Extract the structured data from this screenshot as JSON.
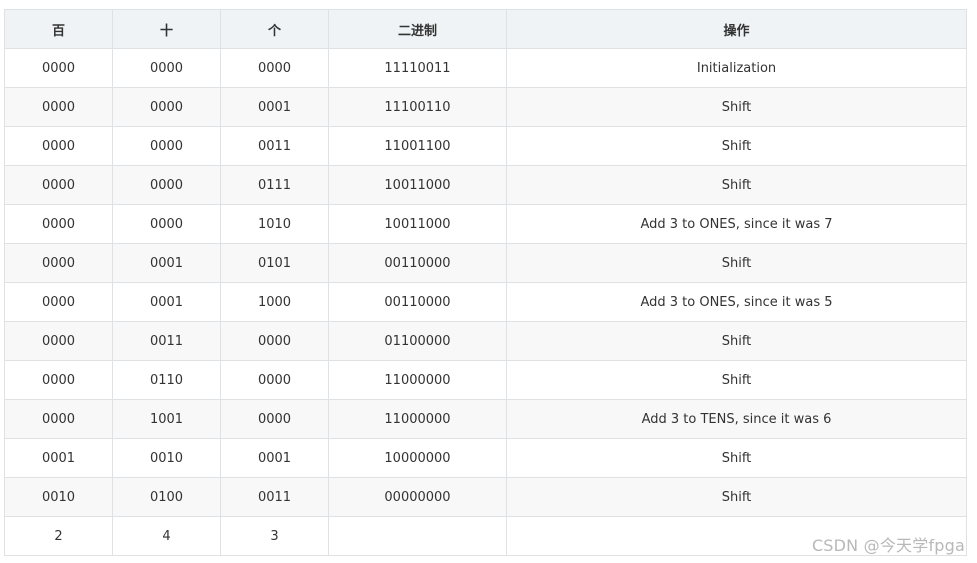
{
  "table": {
    "headers": [
      "百",
      "十",
      "个",
      "二进制",
      "操作"
    ],
    "rows": [
      [
        "0000",
        "0000",
        "0000",
        "11110011",
        "Initialization"
      ],
      [
        "0000",
        "0000",
        "0001",
        "11100110",
        "Shift"
      ],
      [
        "0000",
        "0000",
        "0011",
        "11001100",
        "Shift"
      ],
      [
        "0000",
        "0000",
        "0111",
        "10011000",
        "Shift"
      ],
      [
        "0000",
        "0000",
        "1010",
        "10011000",
        "Add 3 to ONES, since it was 7"
      ],
      [
        "0000",
        "0001",
        "0101",
        "00110000",
        "Shift"
      ],
      [
        "0000",
        "0001",
        "1000",
        "00110000",
        "Add 3 to ONES, since it was 5"
      ],
      [
        "0000",
        "0011",
        "0000",
        "01100000",
        "Shift"
      ],
      [
        "0000",
        "0110",
        "0000",
        "11000000",
        "Shift"
      ],
      [
        "0000",
        "1001",
        "0000",
        "11000000",
        "Add 3 to TENS, since it was 6"
      ],
      [
        "0001",
        "0010",
        "0001",
        "10000000",
        "Shift"
      ],
      [
        "0010",
        "0100",
        "0011",
        "00000000",
        "Shift"
      ],
      [
        "2",
        "4",
        "3",
        "",
        ""
      ]
    ]
  },
  "watermark": "CSDN @今天学fpga"
}
